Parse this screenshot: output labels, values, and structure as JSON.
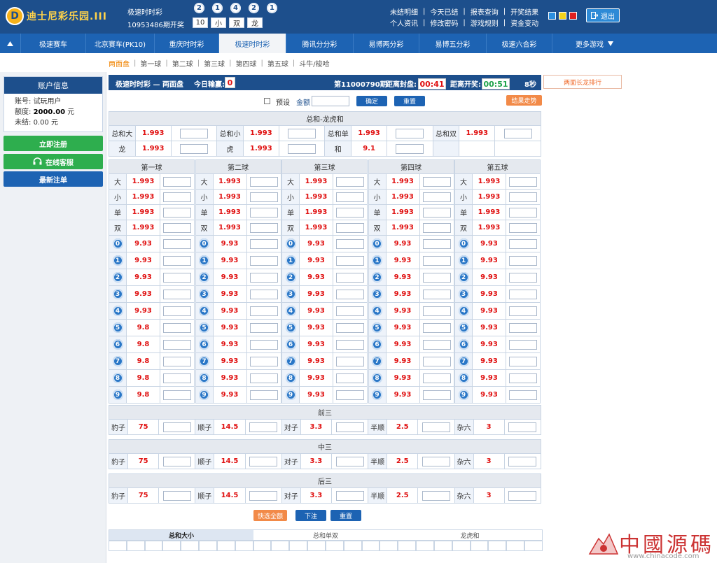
{
  "header": {
    "logo_text": "迪士尼彩乐园",
    "logo_suffix": ".III",
    "lottery_name": "极速时时彩",
    "issue_open": "10953486期开奖",
    "balls": [
      "2",
      "1",
      "4",
      "2",
      "1"
    ],
    "results": [
      "10",
      "小",
      "双",
      "龙"
    ],
    "links_row1": [
      "未结明细",
      "今天已结",
      "报表查询",
      "开奖结果"
    ],
    "links_row2": [
      "个人资讯",
      "修改密码",
      "游戏规则",
      "资金变动"
    ],
    "skin_colors": [
      "#2b8fdf",
      "#f2d21a",
      "#e02020"
    ],
    "logout": "退出",
    "logout_icon": "logout-icon"
  },
  "nav": {
    "items": [
      "极速赛车",
      "北京赛车(PK10)",
      "重庆时时彩",
      "极速时时彩",
      "腾讯分分彩",
      "易博两分彩",
      "易博五分彩",
      "极速六合彩",
      "更多游戏"
    ],
    "active": "极速时时彩",
    "toggle_icon": "triangle-up-icon"
  },
  "subnav": [
    "两面盘",
    "第一球",
    "第二球",
    "第三球",
    "第四球",
    "第五球",
    "斗牛/梭哈"
  ],
  "account": {
    "title": "账户信息",
    "account_label": "账号:",
    "account_value": "试玩用户",
    "quota_label": "额度:",
    "quota_value": "2000.00",
    "quota_unit": "元",
    "unsettled_label": "未结:",
    "unsettled_value": "0.00 元",
    "register": "立即注册",
    "service": "在线客服",
    "latest": "最新注单",
    "service_icon": "headset-icon"
  },
  "infobar": {
    "title": "极速时时彩 — 两面盘",
    "today_label": "今日输赢:",
    "today_value": "0",
    "issue": "第11000790期",
    "close_label": "距离封盘:",
    "close_time": "00:41",
    "open_label": "距离开奖:",
    "open_time": "00:51",
    "refresh": "8秒",
    "long_dragon": "两面长龙排行"
  },
  "amount_row": {
    "preset": "预设",
    "amount": "金额",
    "confirm": "确定",
    "reset": "重置",
    "trend": "结果走势"
  },
  "sum_section": {
    "title": "总和-龙虎和",
    "rows": [
      [
        {
          "label": "总和大",
          "odds": "1.993"
        },
        {
          "label": "总和小",
          "odds": "1.993"
        },
        {
          "label": "总和单",
          "odds": "1.993"
        },
        {
          "label": "总和双",
          "odds": "1.993"
        }
      ],
      [
        {
          "label": "龙",
          "odds": "1.993"
        },
        {
          "label": "虎",
          "odds": "1.993"
        },
        {
          "label": "和",
          "odds": "9.1"
        }
      ]
    ]
  },
  "balls_section": {
    "titles": [
      "第一球",
      "第二球",
      "第三球",
      "第四球",
      "第五球"
    ],
    "two_side_labels": [
      "大",
      "小",
      "单",
      "双"
    ],
    "two_side_odds": "1.993",
    "numbers": [
      "0",
      "1",
      "2",
      "3",
      "4",
      "5",
      "6",
      "7",
      "8",
      "9"
    ],
    "number_odds": [
      [
        "9.93",
        "9.93",
        "9.93",
        "9.93",
        "9.93",
        "9.8",
        "9.8",
        "9.8",
        "9.8",
        "9.8"
      ],
      [
        "9.93",
        "9.93",
        "9.93",
        "9.93",
        "9.93",
        "9.93",
        "9.93",
        "9.93",
        "9.93",
        "9.93"
      ],
      [
        "9.93",
        "9.93",
        "9.93",
        "9.93",
        "9.93",
        "9.93",
        "9.93",
        "9.93",
        "9.93",
        "9.93"
      ],
      [
        "9.93",
        "9.93",
        "9.93",
        "9.93",
        "9.93",
        "9.93",
        "9.93",
        "9.93",
        "9.93",
        "9.93"
      ],
      [
        "9.93",
        "9.93",
        "9.93",
        "9.93",
        "9.93",
        "9.93",
        "9.93",
        "9.93",
        "9.93",
        "9.93"
      ]
    ]
  },
  "three_sections": [
    {
      "title": "前三",
      "items": [
        {
          "label": "豹子",
          "odds": "75"
        },
        {
          "label": "顺子",
          "odds": "14.5"
        },
        {
          "label": "对子",
          "odds": "3.3"
        },
        {
          "label": "半顺",
          "odds": "2.5"
        },
        {
          "label": "杂六",
          "odds": "3"
        }
      ]
    },
    {
      "title": "中三",
      "items": [
        {
          "label": "豹子",
          "odds": "75"
        },
        {
          "label": "顺子",
          "odds": "14.5"
        },
        {
          "label": "对子",
          "odds": "3.3"
        },
        {
          "label": "半顺",
          "odds": "2.5"
        },
        {
          "label": "杂六",
          "odds": "3"
        }
      ]
    },
    {
      "title": "后三",
      "items": [
        {
          "label": "豹子",
          "odds": "75"
        },
        {
          "label": "顺子",
          "odds": "14.5"
        },
        {
          "label": "对子",
          "odds": "3.3"
        },
        {
          "label": "半顺",
          "odds": "2.5"
        },
        {
          "label": "杂六",
          "odds": "3"
        }
      ]
    }
  ],
  "actions": {
    "quick_all": "快选全额",
    "bet": "下注",
    "reset": "重置"
  },
  "bottom_tabs": [
    "总和大小",
    "总和单双",
    "龙虎和"
  ],
  "watermark": {
    "title": "中國源碼",
    "url": "www.chinacode.com"
  }
}
